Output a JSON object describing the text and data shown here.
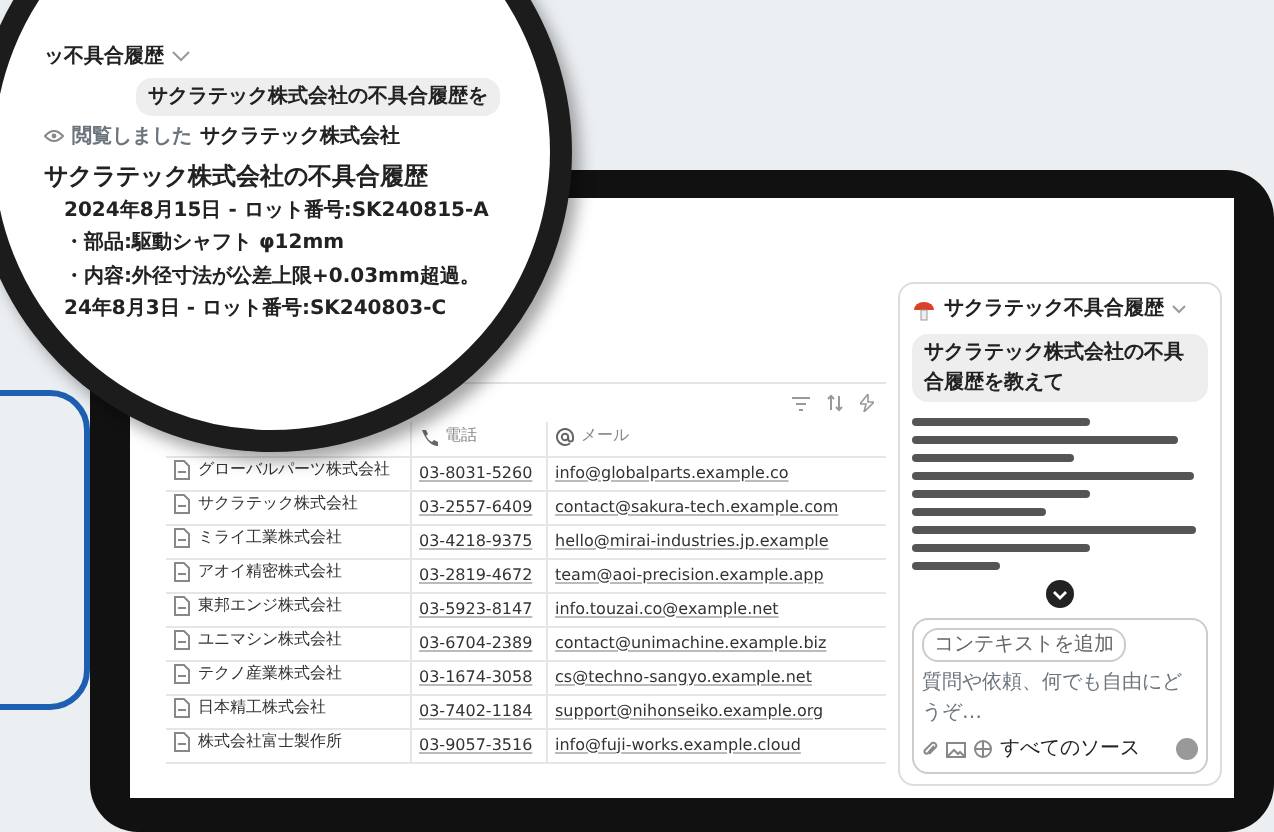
{
  "magnifier": {
    "chat_title": "ッ不具合履歴",
    "user_message": "サクラテック株式会社の不具合履歴を",
    "status_label": "閲覧しました",
    "status_source": "サクラテック株式会社",
    "answer_title": "サクラテック株式会社の不具合履歴",
    "answer_lines": [
      "2024年8月15日 - ロット番号:SK240815-A",
      "・部品:駆動シャフト φ12mm",
      "・内容:外径寸法が公差上限+0.03mm超過。",
      "24年8月3日 - ロット番号:SK240803-C"
    ]
  },
  "table": {
    "columns": [
      {
        "kind": "phone",
        "label": "電話"
      },
      {
        "kind": "email",
        "label": "メール"
      }
    ],
    "rows": [
      {
        "name": "グローバルパーツ株式会社",
        "phone": "03-8031-5260",
        "email": "info@globalparts.example.co"
      },
      {
        "name": "サクラテック株式会社",
        "phone": "03-2557-6409",
        "email": "contact@sakura-tech.example.com"
      },
      {
        "name": "ミライ工業株式会社",
        "phone": "03-4218-9375",
        "email": "hello@mirai-industries.jp.example"
      },
      {
        "name": "アオイ精密株式会社",
        "phone": "03-2819-4672",
        "email": "team@aoi-precision.example.app"
      },
      {
        "name": "東邦エンジ株式会社",
        "phone": "03-5923-8147",
        "email": "info.touzai.co@example.net"
      },
      {
        "name": "ユニマシン株式会社",
        "phone": "03-6704-2389",
        "email": "contact@unimachine.example.biz"
      },
      {
        "name": "テクノ産業株式会社",
        "phone": "03-1674-3058",
        "email": "cs@techno-sangyo.example.net"
      },
      {
        "name": "日本精工株式会社",
        "phone": "03-7402-1184",
        "email": "support@nihonseiko.example.org"
      },
      {
        "name": "株式会社富士製作所",
        "phone": "03-9057-3516",
        "email": "info@fuji-works.example.cloud"
      }
    ]
  },
  "chat_panel": {
    "title": "サクラテック不具合履歴",
    "user_message": "サクラテック株式会社の不具合履歴を教えて",
    "context_chip": "コンテキストを追加",
    "placeholder": "質問や依頼、何でも自由にどうぞ…",
    "source_label": "すべてのソース"
  }
}
